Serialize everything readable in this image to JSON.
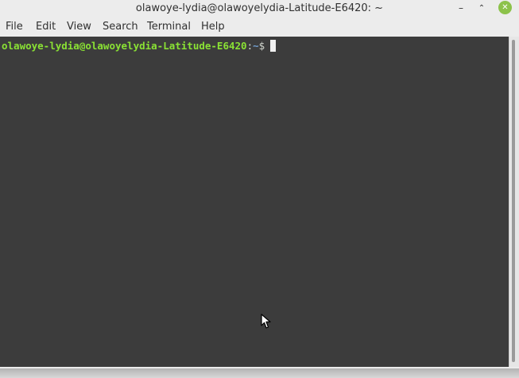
{
  "window": {
    "title": "olawoye-lydia@olawoyelydia-Latitude-E6420: ~",
    "controls": {
      "minimize": "–",
      "maximize": "⌃",
      "close": "✕"
    }
  },
  "menubar": {
    "items": [
      {
        "label": "File"
      },
      {
        "label": "Edit"
      },
      {
        "label": "View"
      },
      {
        "label": "Search"
      },
      {
        "label": "Terminal"
      },
      {
        "label": "Help"
      }
    ]
  },
  "terminal": {
    "prompt": {
      "user_host": "olawoye-lydia@olawoyelydia-Latitude-E6420",
      "separator": ":",
      "path": "~",
      "symbol": "$"
    }
  },
  "colors": {
    "prompt_user": "#8ae234",
    "prompt_path": "#729fcf",
    "terminal_bg": "#3c3c3c",
    "close_button": "#8cc24a"
  }
}
